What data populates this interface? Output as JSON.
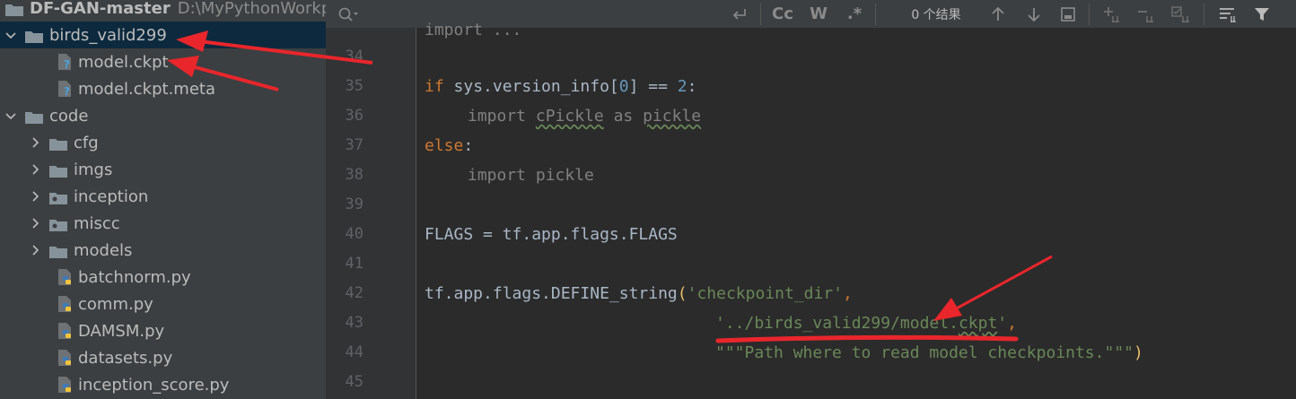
{
  "sidebar": {
    "project_name": "DF-GAN-master",
    "project_path": "D:\\MyPythonWorkpl",
    "items": [
      {
        "label": "birds_valid299",
        "type": "folder",
        "open": true
      },
      {
        "label": "model.ckpt",
        "type": "file"
      },
      {
        "label": "model.ckpt.meta",
        "type": "file"
      },
      {
        "label": "code",
        "type": "folder",
        "open": true
      },
      {
        "label": "cfg",
        "type": "folder"
      },
      {
        "label": "imgs",
        "type": "folder"
      },
      {
        "label": "inception",
        "type": "package"
      },
      {
        "label": "miscc",
        "type": "package"
      },
      {
        "label": "models",
        "type": "folder"
      },
      {
        "label": "batchnorm.py",
        "type": "py"
      },
      {
        "label": "comm.py",
        "type": "py"
      },
      {
        "label": "DAMSM.py",
        "type": "py"
      },
      {
        "label": "datasets.py",
        "type": "py"
      },
      {
        "label": "inception_score.py",
        "type": "py"
      }
    ]
  },
  "findbar": {
    "case_label": "Cc",
    "word_label": "W",
    "regex_label": ".*",
    "result_text": "0 个结果"
  },
  "editor": {
    "line_numbers": [
      "34",
      "35",
      "36",
      "37",
      "38",
      "39",
      "40",
      "41",
      "42",
      "43",
      "44",
      "45"
    ],
    "line_top_partial": "import ...",
    "l35_kw": "if",
    "l35_a": " sys.version_info[",
    "l35_num": "0",
    "l35_b": "] == ",
    "l35_num2": "2",
    "l35_c": ":",
    "l36_kw": "import",
    "l36_mod": "cPickle",
    "l36_as": " as ",
    "l36_alias": "pickle",
    "l37_kw": "else",
    "l37_c": ":",
    "l38_kw": "import",
    "l38_mod": " pickle",
    "l40": "FLAGS = tf.app.flags.FLAGS",
    "l42_a": "tf.app.flags.DEFINE_string",
    "l42_p": "(",
    "l42_str": "'checkpoint_dir'",
    "l42_c": ",",
    "l43_str_a": "'../birds_valid299/model.",
    "l43_str_b": "ckpt",
    "l43_str_c": "'",
    "l43_c": ",",
    "l44_str": "\"\"\"Path where to read model checkpoints.\"\"\"",
    "l44_p": ")"
  },
  "colors": {
    "arrow": "#e8262c"
  }
}
